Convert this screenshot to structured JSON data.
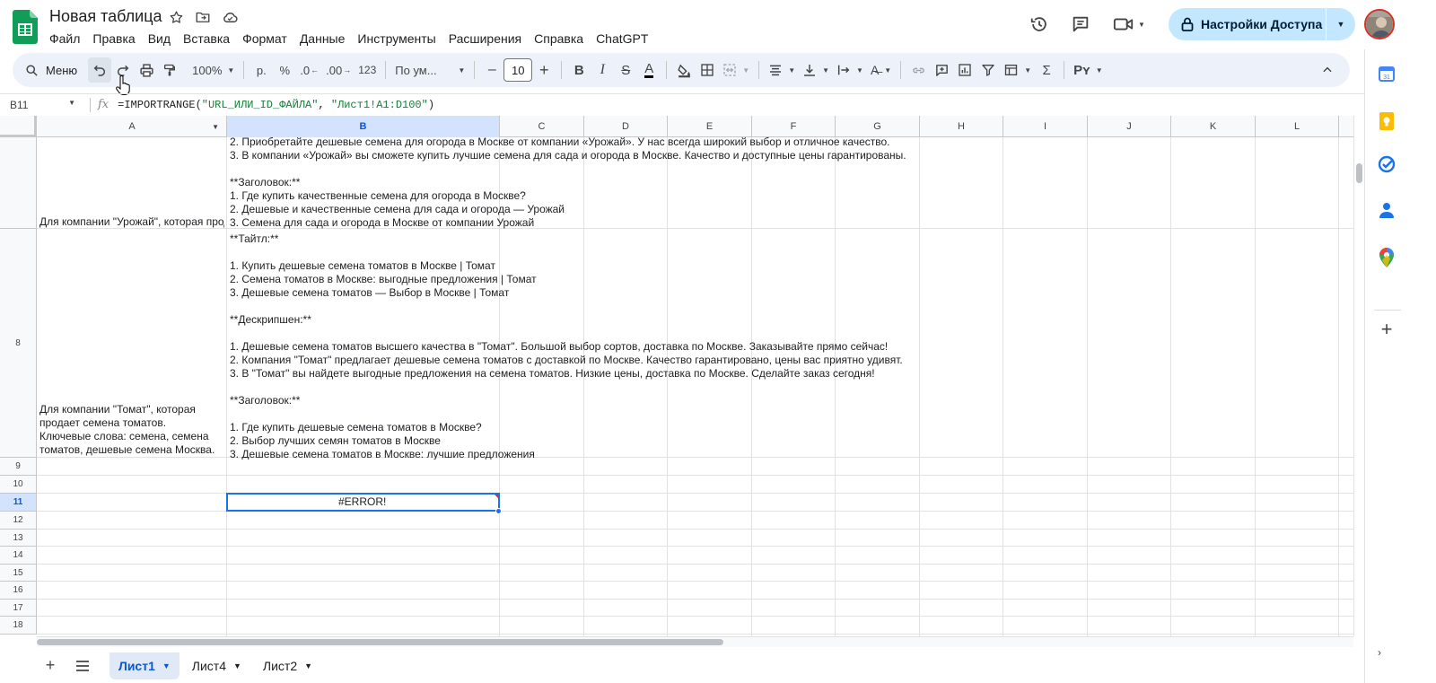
{
  "doc_title": "Новая таблица",
  "menu": [
    "Файл",
    "Правка",
    "Вид",
    "Вставка",
    "Формат",
    "Данные",
    "Инструменты",
    "Расширения",
    "Справка",
    "ChatGPT"
  ],
  "share_label": "Настройки Доступа",
  "toolbar": {
    "search_label": "Меню",
    "zoom": "100%",
    "currency": "р.",
    "percent": "%",
    "dec_decrease": ".0",
    "dec_increase": ".00",
    "more_formats": "123",
    "font": "По ум...",
    "font_size": "10",
    "minus": "–",
    "plus": "+",
    "sigma": "Σ"
  },
  "formula_bar": {
    "name_box": "B11",
    "fx": "fx",
    "formula_fn": "=IMPORTRANGE(",
    "formula_arg1": "\"URL_ИЛИ_ID_ФАЙЛА\"",
    "formula_sep": ", ",
    "formula_arg2": "\"Лист1!A1:D100\"",
    "formula_end": ")"
  },
  "columns": [
    "A",
    "B",
    "C",
    "D",
    "E",
    "F",
    "G",
    "H",
    "I",
    "J",
    "K",
    "L"
  ],
  "selected_column": "B",
  "rows": {
    "row7": "",
    "row8": "8",
    "row9": "9",
    "row10": "10",
    "row11": "11",
    "row12": "12",
    "row13": "13",
    "row14": "14",
    "row15": "15",
    "row16": "16",
    "row17": "17",
    "row18": "18"
  },
  "cells": {
    "A7": "Для компании \"Урожай\", которая продает",
    "B7": "2. Приобретайте дешевые семена для огорода в Москве от компании «Урожай». У нас всегда широкий выбор и отличное качество.\n3. В компании «Урожай» вы сможете купить лучшие семена для сада и огорода в Москве. Качество и доступные цены гарантированы.\n\n**Заголовок:**\n1. Где купить качественные семена для огорода в Москве?\n2. Дешевые и качественные семена для сада и огорода — Урожай\n3. Семена для сада и огорода в Москве от компании Урожай",
    "A8": "Для компании \"Томат\", которая\nпродает семена томатов.\nКлючевые слова: семена, семена\nтоматов, дешевые семена Москва.",
    "B8": "**Тайтл:**\n\n1. Купить дешевые семена томатов в Москве | Томат\n2. Семена томатов в Москве: выгодные предложения | Томат\n3. Дешевые семена томатов — Выбор в Москве | Томат\n\n**Дескрипшен:**\n\n1. Дешевые семена томатов высшего качества в \"Томат\". Большой выбор сортов, доставка по Москве. Заказывайте прямо сейчас!\n2. Компания \"Томат\" предлагает дешевые семена томатов с доставкой по Москве. Качество гарантировано, цены вас приятно удивят.\n3. В \"Томат\" вы найдете выгодные предложения на семена томатов. Низкие цены, доставка по Москве. Сделайте заказ сегодня!\n\n**Заголовок:**\n\n1. Где купить дешевые семена томатов в Москве?\n2. Выбор лучших семян томатов в Москве\n3. Дешевые семена томатов в Москве: лучшие предложения",
    "B11": "#ERROR!"
  },
  "sheets": [
    {
      "label": "Лист1",
      "active": true
    },
    {
      "label": "Лист4",
      "active": false
    },
    {
      "label": "Лист2",
      "active": false
    }
  ],
  "colors": {
    "accent": "#1a73e8",
    "share_bg": "#c2e7ff",
    "toolbar_bg": "#edf2fa",
    "selected_header": "#d3e3fd",
    "error": "#d93025"
  }
}
